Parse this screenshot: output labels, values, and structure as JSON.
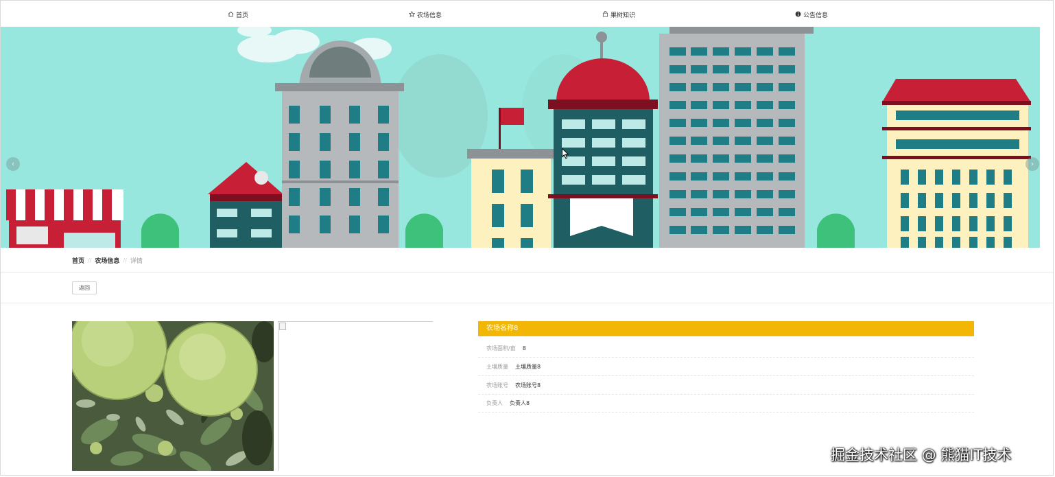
{
  "nav": {
    "items": [
      {
        "label": "首页",
        "icon": "home-icon"
      },
      {
        "label": "农场信息",
        "icon": "star-icon"
      },
      {
        "label": "果树知识",
        "icon": "bag-icon"
      },
      {
        "label": "公告信息",
        "icon": "info-icon"
      }
    ]
  },
  "banner": {
    "prev_icon": "chevron-left-icon",
    "next_icon": "chevron-right-icon",
    "sky_color": "#97e7de"
  },
  "breadcrumb": {
    "items": [
      "首页",
      "农场信息",
      "详情"
    ]
  },
  "back_button": {
    "label": "返回"
  },
  "detail": {
    "title": "农场名称8",
    "accent_color": "#f2b705",
    "rows": [
      {
        "label": "农场面积/亩",
        "value": "8"
      },
      {
        "label": "土壤质量",
        "value": "土壤质量8"
      },
      {
        "label": "农场账号",
        "value": "农场账号8"
      },
      {
        "label": "负责人",
        "value": "负责人8"
      }
    ]
  },
  "watermark": "掘金技术社区 @ 熊猫IT技术"
}
